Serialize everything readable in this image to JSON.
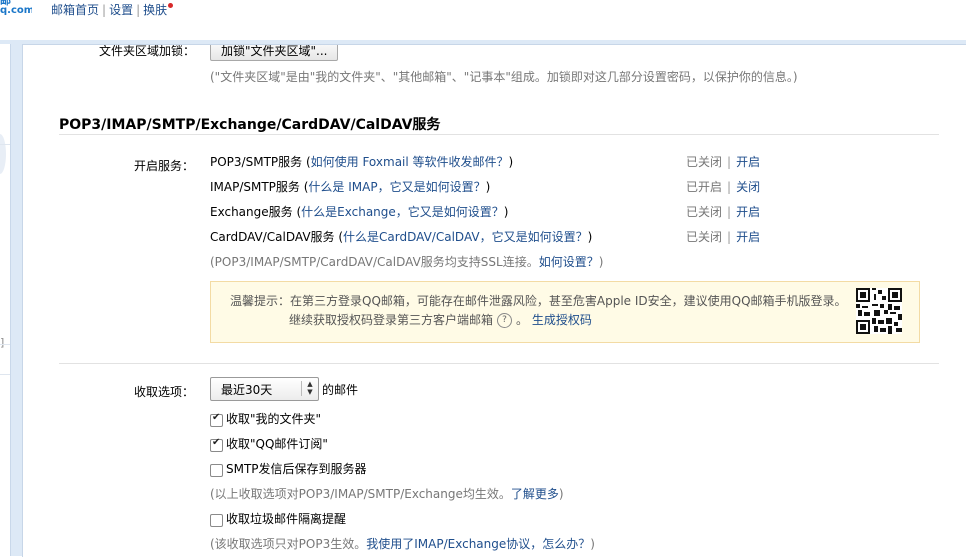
{
  "topbar": {
    "logo_line1": "邮",
    "logo_line2": "q.com",
    "link_home": "邮箱首页",
    "link_settings": "设置",
    "link_skin": "换肤",
    "separator": "|"
  },
  "left": {
    "bracket": "]"
  },
  "folder_lock": {
    "label": "文件夹区域加锁：",
    "button": "加锁\"文件夹区域\"...",
    "hint": "(\"文件夹区域\"是由\"我的文件夹\"、\"其他邮箱\"、\"记事本\"组成。加锁即对这几部分设置密码，以保护你的信息。)"
  },
  "services": {
    "title": "POP3/IMAP/SMTP/Exchange/CardDAV/CalDAV服务",
    "label": "开启服务：",
    "items": [
      {
        "name": "POP3/SMTP服务",
        "help": "如何使用 Foxmail 等软件收发邮件？",
        "status": "已关闭",
        "action": "开启"
      },
      {
        "name": "IMAP/SMTP服务",
        "help": "什么是 IMAP，它又是如何设置？",
        "status": "已开启",
        "action": "关闭"
      },
      {
        "name": "Exchange服务",
        "help": "什么是Exchange，它又是如何设置？",
        "status": "已关闭",
        "action": "开启"
      },
      {
        "name": "CardDAV/CalDAV服务",
        "help": "什么是CardDAV/CalDAV，它又是如何设置？",
        "status": "已关闭",
        "action": "开启"
      }
    ],
    "ssl_note": "(POP3/IMAP/SMTP/CardDAV/CalDAV服务均支持SSL连接。",
    "ssl_link": "如何设置？",
    "ssl_close": ")",
    "tip_line1": "温馨提示：在第三方登录QQ邮箱，可能存在邮件泄露风险，甚至危害Apple ID安全，建议使用QQ邮箱手机版登录。",
    "tip_line2": "继续获取授权码登录第三方客户端邮箱",
    "tip_q": "?",
    "tip_sep": "。",
    "tip_link": "生成授权码"
  },
  "receive": {
    "label": "收取选项：",
    "select_value": "最近30天",
    "select_arrow": "▲▼",
    "suffix": "的邮件",
    "opt_my_folders": "收取\"我的文件夹\"",
    "opt_subscription": "收取\"QQ邮件订阅\"",
    "opt_smtp_save": "SMTP发信后保存到服务器",
    "note1": "(以上收取选项对POP3/IMAP/SMTP/Exchange均生效。",
    "note1_link": "了解更多",
    "note1_close": ")",
    "opt_spam": "收取垃圾邮件隔离提醒",
    "note2": "(该收取选项只对POP3生效。",
    "note2_link": "我使用了IMAP/Exchange协议，怎么办？",
    "note2_close": ")"
  },
  "colors": {
    "link": "#1f4e8c",
    "panel_bg": "#dde9f6",
    "tip_bg": "#fffbe6",
    "notify_dot": "#d7282a"
  }
}
